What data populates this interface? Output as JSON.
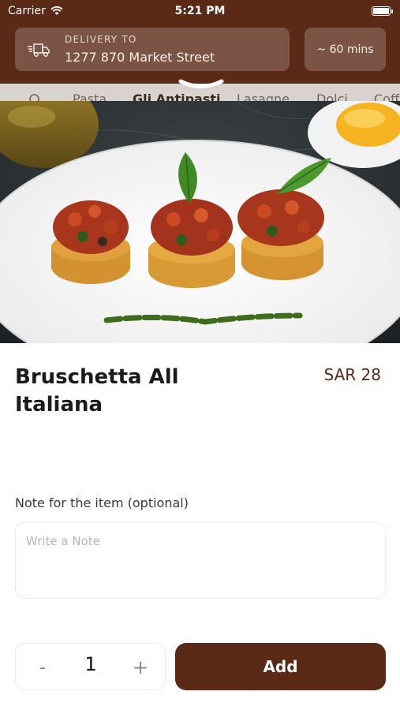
{
  "status_bar": {
    "carrier": "Carrier",
    "time": "5:21 PM"
  },
  "header": {
    "delivery_label": "DELIVERY TO",
    "address": "1277 870 Market Street",
    "eta": "~ 60 mins",
    "icons": {
      "delivery": "delivery-truck-icon",
      "wifi": "wifi-icon",
      "battery": "battery-icon"
    }
  },
  "category_tabs": {
    "search_icon": "search-icon",
    "items": [
      {
        "label": "Pasta",
        "active": false
      },
      {
        "label": "Gli Antipasti",
        "active": true
      },
      {
        "label": "Lasagne",
        "active": false
      },
      {
        "label": "Dolci",
        "active": false
      },
      {
        "label": "Coff",
        "active": false
      }
    ]
  },
  "product": {
    "image": "bruschetta-photo",
    "name": "Bruschetta All Italiana",
    "price": "SAR 28"
  },
  "note": {
    "label": "Note for the item (optional)",
    "placeholder": "Write a Note",
    "value": ""
  },
  "order": {
    "minus": "-",
    "quantity": "1",
    "plus": "+",
    "add_label": "Add"
  },
  "colors": {
    "brand": "#5a2a17",
    "price": "#5a2a17"
  }
}
